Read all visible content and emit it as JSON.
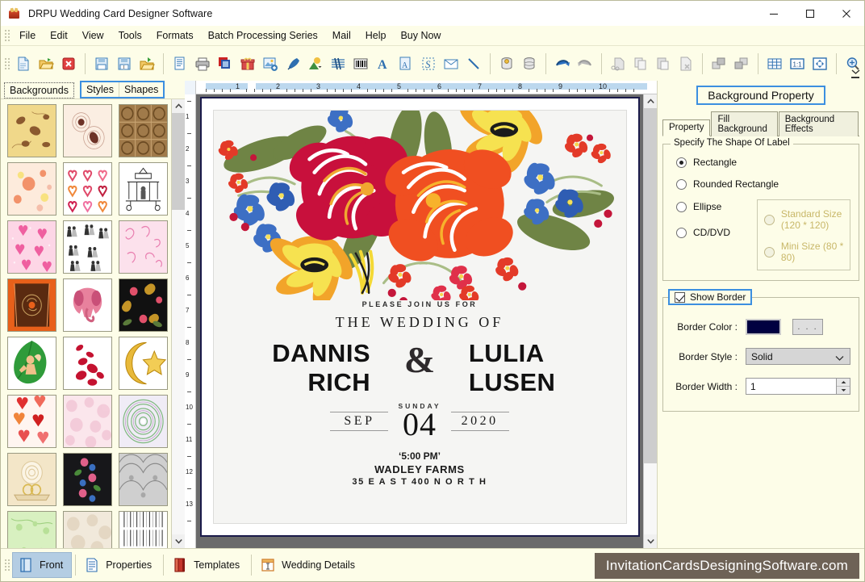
{
  "window": {
    "title": "DRPU Wedding Card Designer Software",
    "icon": "app-gift-icon",
    "minimize": "minimize-icon",
    "maximize": "maximize-icon",
    "close": "close-icon"
  },
  "menubar": {
    "items": [
      {
        "label": "File"
      },
      {
        "label": "Edit"
      },
      {
        "label": "View"
      },
      {
        "label": "Tools"
      },
      {
        "label": "Formats"
      },
      {
        "label": "Batch Processing Series"
      },
      {
        "label": "Mail"
      },
      {
        "label": "Help"
      },
      {
        "label": "Buy Now"
      }
    ]
  },
  "toolbar": {
    "groups": [
      {
        "buttons": [
          {
            "name": "new-document-icon"
          },
          {
            "name": "open-folder-icon"
          },
          {
            "name": "close-document-icon"
          }
        ]
      },
      {
        "buttons": [
          {
            "name": "save-icon"
          },
          {
            "name": "save-as-icon"
          },
          {
            "name": "save-to-folder-icon"
          }
        ]
      },
      {
        "buttons": [
          {
            "name": "print-preview-icon"
          },
          {
            "name": "print-icon"
          },
          {
            "name": "batch-print-icon"
          },
          {
            "name": "gift-icon"
          },
          {
            "name": "insert-image-icon"
          },
          {
            "name": "pen-tool-icon"
          },
          {
            "name": "shape-picture-icon"
          },
          {
            "name": "watermark-icon"
          },
          {
            "name": "barcode-icon"
          },
          {
            "name": "text-icon"
          },
          {
            "name": "text-box-icon"
          },
          {
            "name": "signature-icon"
          },
          {
            "name": "envelope-icon"
          },
          {
            "name": "line-tool-icon"
          }
        ]
      },
      {
        "buttons": [
          {
            "name": "database-key-icon"
          },
          {
            "name": "database-icon"
          }
        ]
      },
      {
        "buttons": [
          {
            "name": "undo-icon"
          },
          {
            "name": "redo-icon"
          }
        ]
      },
      {
        "buttons": [
          {
            "name": "cut-icon"
          },
          {
            "name": "copy-icon"
          },
          {
            "name": "paste-icon"
          },
          {
            "name": "delete-icon"
          }
        ]
      },
      {
        "buttons": [
          {
            "name": "bring-to-front-icon"
          },
          {
            "name": "send-to-back-icon"
          }
        ]
      },
      {
        "buttons": [
          {
            "name": "grid-icon"
          },
          {
            "name": "actual-size-icon"
          },
          {
            "name": "fit-to-window-icon"
          }
        ]
      },
      {
        "buttons": [
          {
            "name": "zoom-in-icon"
          }
        ]
      }
    ],
    "overflow": "toolbar-overflow-icon"
  },
  "left_panel": {
    "tabs": [
      {
        "label": "Backgrounds",
        "selected": true
      },
      {
        "label": "Styles",
        "selected": false
      },
      {
        "label": "Shapes",
        "selected": false
      }
    ],
    "thumbnails": [
      {
        "id": 1,
        "name": "golden-butterfly-pattern"
      },
      {
        "id": 2,
        "name": "beige-lace-medallion"
      },
      {
        "id": 3,
        "name": "brown-geometric-tiles"
      },
      {
        "id": 4,
        "name": "peach-floral-pastel"
      },
      {
        "id": 5,
        "name": "hand-drawn-hearts"
      },
      {
        "id": 6,
        "name": "mandap-line-art"
      },
      {
        "id": 7,
        "name": "pink-hearts-dots"
      },
      {
        "id": 8,
        "name": "wedding-couple-sketches"
      },
      {
        "id": 9,
        "name": "pink-heart-swirls"
      },
      {
        "id": 10,
        "name": "orange-ganesha-rug"
      },
      {
        "id": 11,
        "name": "pink-elephant"
      },
      {
        "id": 12,
        "name": "black-gold-floral"
      },
      {
        "id": 13,
        "name": "green-leaf-cherub"
      },
      {
        "id": 14,
        "name": "red-rose-petals"
      },
      {
        "id": 15,
        "name": "gold-crescent-star"
      },
      {
        "id": 16,
        "name": "red-glitter-hearts"
      },
      {
        "id": 17,
        "name": "pale-pink-marble"
      },
      {
        "id": 18,
        "name": "green-mandala"
      },
      {
        "id": 19,
        "name": "cream-rose-rings"
      },
      {
        "id": 20,
        "name": "black-floral-border"
      },
      {
        "id": 21,
        "name": "grey-damask-lace"
      },
      {
        "id": 22,
        "name": "light-green-floral"
      },
      {
        "id": 23,
        "name": "cream-texture"
      },
      {
        "id": 24,
        "name": "black-white-lace-stripes"
      }
    ],
    "scroll": {
      "up": "scroll-up-icon",
      "down": "scroll-down-icon"
    }
  },
  "canvas": {
    "h_ruler_labels": [
      "1",
      "2",
      "3",
      "4",
      "5",
      "6",
      "7",
      "8",
      "9",
      "10"
    ],
    "v_ruler_labels": [
      "1",
      "2",
      "3",
      "4",
      "5",
      "6",
      "7",
      "8",
      "9",
      "10",
      "11",
      "12",
      "13"
    ],
    "scroll": {
      "up": "scroll-up-icon",
      "down": "scroll-down-icon"
    },
    "card": {
      "artwork": "floral-bouquet-illustration",
      "join_line": "PLEASE JOIN US FOR",
      "wedding_line": "THE WEDDING OF",
      "bride_groom_left": [
        "DANNIS",
        "RICH"
      ],
      "ampersand": "&",
      "bride_groom_right": [
        "LULIA",
        "LUSEN"
      ],
      "weekday": "SUNDAY",
      "month": "SEP",
      "day": "04",
      "year": "2020",
      "time": "‘5:00 PM’",
      "venue": "WADLEY FARMS",
      "address": "35  E A S T 400 N O R T H"
    }
  },
  "right_panel": {
    "title": "Background Property",
    "tabs": [
      {
        "label": "Property",
        "active": true
      },
      {
        "label": "Fill Background",
        "active": false
      },
      {
        "label": "Background Effects",
        "active": false
      }
    ],
    "shape_group": {
      "legend": "Specify The Shape Of Label",
      "options": [
        {
          "label": "Rectangle",
          "checked": true,
          "disabled": false
        },
        {
          "label": "Rounded Rectangle",
          "checked": false,
          "disabled": false
        },
        {
          "label": "Ellipse",
          "checked": false,
          "disabled": false
        },
        {
          "label": "CD/DVD",
          "checked": false,
          "disabled": false
        }
      ],
      "cd_sizes": [
        {
          "label": "Standard Size (120 * 120)",
          "checked": false,
          "disabled": true
        },
        {
          "label": "Mini Size (80 * 80)",
          "checked": false,
          "disabled": true
        }
      ]
    },
    "border_group": {
      "show_border_label": "Show Border",
      "show_border_checked": true,
      "color_label": "Border Color :",
      "color_value": "#000040",
      "browse_label": ". . .",
      "style_label": "Border Style :",
      "style_value": "Solid",
      "width_label": "Border Width :",
      "width_value": "1"
    }
  },
  "bottom_bar": {
    "items": [
      {
        "label": "Front",
        "icon": "front-card-icon",
        "selected": true
      },
      {
        "label": "Properties",
        "icon": "properties-icon",
        "selected": false
      },
      {
        "label": "Templates",
        "icon": "templates-icon",
        "selected": false
      },
      {
        "label": "Wedding Details",
        "icon": "wedding-details-icon",
        "selected": false
      }
    ],
    "brand": "InvitationCardsDesigningSoftware.com",
    "brand_bg": "#6e6256"
  },
  "colors": {
    "chrome_bg": "#fdfde8",
    "canvas_bg": "#6b6b6b",
    "highlight_blue": "#3c8fe0",
    "selection_blue": "#b4cde3"
  }
}
